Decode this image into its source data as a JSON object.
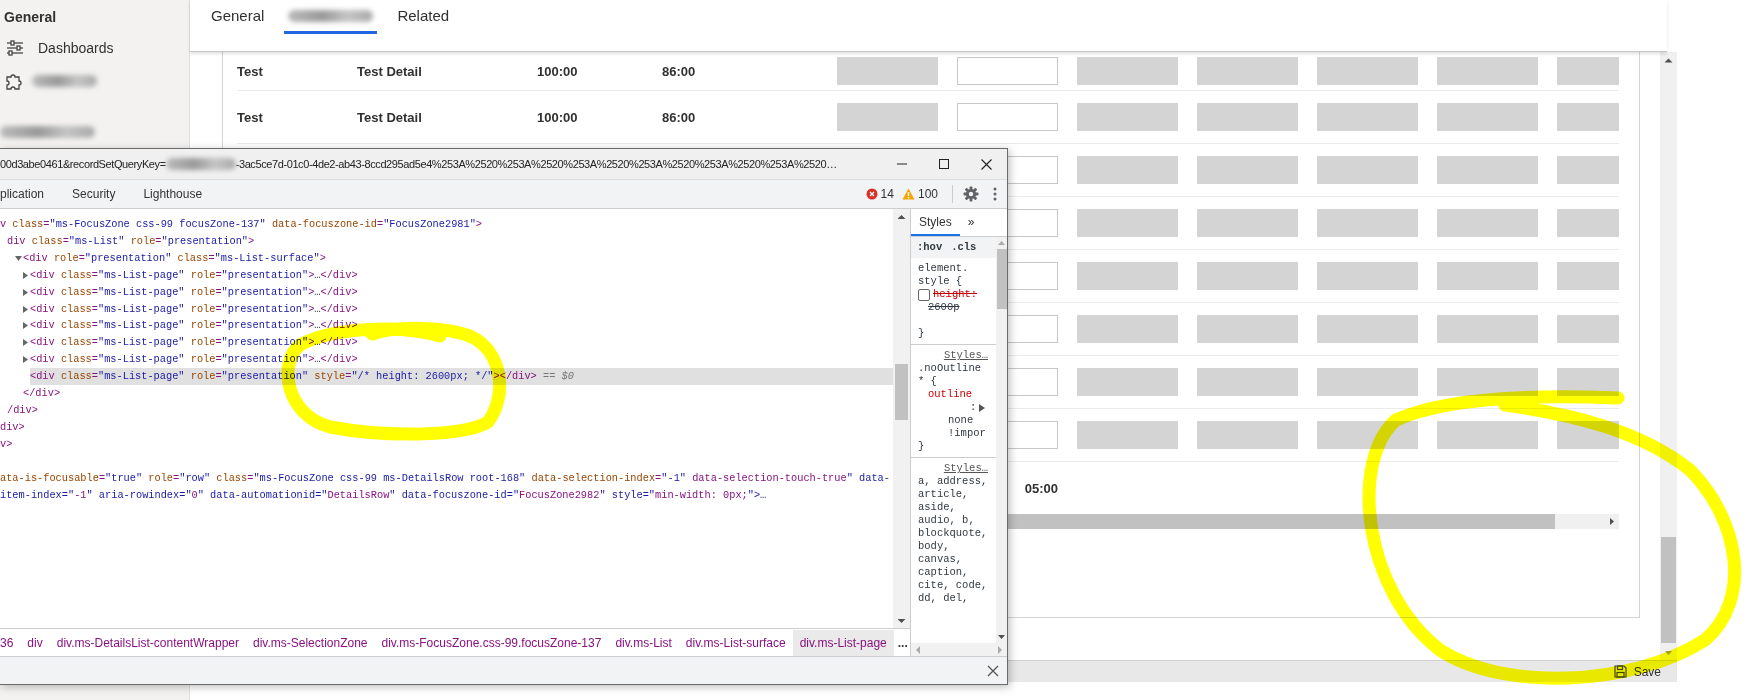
{
  "sidebar": {
    "heading": "General",
    "items": [
      {
        "kind": "link",
        "label": "Dashboards"
      },
      {
        "kind": "redacted"
      },
      {
        "kind": "redacted"
      }
    ]
  },
  "tabs": [
    {
      "kind": "text",
      "label": "General",
      "selected": false
    },
    {
      "kind": "redacted",
      "selected": true
    },
    {
      "kind": "text",
      "label": "Related",
      "selected": false
    }
  ],
  "table": {
    "rows": [
      {
        "kind": "data",
        "cells": [
          "Test",
          "Test Detail",
          "100:00",
          "86:00"
        ]
      },
      {
        "kind": "data",
        "cells": [
          "Test",
          "Test Detail",
          "100:00",
          "86:00"
        ]
      },
      {
        "kind": "covered"
      },
      {
        "kind": "covered"
      },
      {
        "kind": "covered"
      },
      {
        "kind": "covered"
      },
      {
        "kind": "covered"
      },
      {
        "kind": "covered"
      },
      {
        "kind": "total",
        "cells": [
          "05:00"
        ]
      }
    ]
  },
  "command_bar": {
    "save": "Save"
  },
  "devtools": {
    "url_start": "00d3abe0461&recordSetQueryKey=",
    "url_end": "-3ac5ce7d-01c0-4de2-ab43-8ccd295ad5e4%253A%2520%253A%2520%253A%2520%253A%2520%253A%2520%253A%2520…",
    "panels": [
      {
        "label": "plication",
        "selected": false
      },
      {
        "label": "Security",
        "selected": false
      },
      {
        "label": "Lighthouse",
        "selected": false
      }
    ],
    "errors": "14",
    "warnings": "100",
    "dom": [
      {
        "text": "v class=\"ms-FocusZone css-99 focusZone-137\" data-focuszone-id=\"FocusZone2981\">",
        "selected": false,
        "children": [
          {
            "text": "div class=\"ms-List\" role=\"presentation\">",
            "selected": false,
            "children": [
              {
                "text": "<div role=\"presentation\" class=\"ms-List-surface\">",
                "expanded": true,
                "selected": false,
                "children": [
                  {
                    "text": "<div class=\"ms-List-page\" role=\"presentation\">…</div>",
                    "expanded": false,
                    "selected": false
                  },
                  {
                    "text": "<div class=\"ms-List-page\" role=\"presentation\">…</div>",
                    "expanded": false,
                    "selected": false
                  },
                  {
                    "text": "<div class=\"ms-List-page\" role=\"presentation\">…</div>",
                    "expanded": false,
                    "selected": false
                  },
                  {
                    "text": "<div class=\"ms-List-page\" role=\"presentation\">…</div>",
                    "expanded": false,
                    "selected": false
                  },
                  {
                    "text": "<div class=\"ms-List-page\" role=\"presentation\">…</div>",
                    "expanded": false,
                    "selected": false
                  },
                  {
                    "text": "<div class=\"ms-List-page\" role=\"presentation\">…</div>",
                    "expanded": false,
                    "selected": false
                  },
                  {
                    "text": "<div class=\"ms-List-page\" role=\"presentation\" style=\"/* height: 2600px; */\"></div>",
                    "selected": true,
                    "suffix": "== $0"
                  }
                ]
              },
              {
                "text": "</div>",
                "selected": false
              }
            ]
          },
          {
            "text": "/div>",
            "selected": false
          }
        ]
      },
      {
        "text": "div>",
        "selected": false
      },
      {
        "text": "v>",
        "selected": false
      },
      {
        "text": "ata-is-focusable=\"true\" role=\"row\" class=\"ms-FocusZone css-99 ms-DetailsRow root-168\" data-selection-index=\"-1\" data-selection-touch-true\" data-item-index=\"-1\" aria-rowindex=\"0\" data-automationid=\"DetailsRow\" data-focuszone-id=\"FocusZone2982\" style=\"min-width: 0px;\">…",
        "selected": false
      }
    ],
    "breadcrumbs": [
      {
        "label": "36",
        "selected": false
      },
      {
        "label": "div",
        "selected": false
      },
      {
        "label": "div.ms-DetailsList-contentWrapper",
        "selected": false
      },
      {
        "label": "div.ms-SelectionZone",
        "selected": false
      },
      {
        "label": "div.ms-FocusZone.css-99.focusZone-137",
        "selected": false
      },
      {
        "label": "div.ms-List",
        "selected": false
      },
      {
        "label": "div.ms-List-surface",
        "selected": false
      },
      {
        "label": "div.ms-List-page",
        "selected": true
      }
    ],
    "breadcrumb_more": "...",
    "styles": {
      "tabs": [
        {
          "label": "Styles",
          "selected": true
        }
      ],
      "more": "»",
      "filters": [
        ":hov",
        ".cls"
      ],
      "rules": [
        {
          "selector": "element. style {",
          "declarations": [
            {
              "property": "height:",
              "value": "2600p",
              "enabled": false
            }
          ],
          "close": "}"
        },
        {
          "source": "Styles…",
          "selector": ".noOutline * {",
          "declarations": [
            {
              "property": "outline",
              "separator": ":",
              "value": "none !impor",
              "enabled": true
            }
          ],
          "close": "}"
        },
        {
          "source": "Styles…",
          "selector": "a, address, article, aside, audio, b, blockquote, body, canvas, caption, cite, code, dd, del,"
        }
      ]
    }
  }
}
